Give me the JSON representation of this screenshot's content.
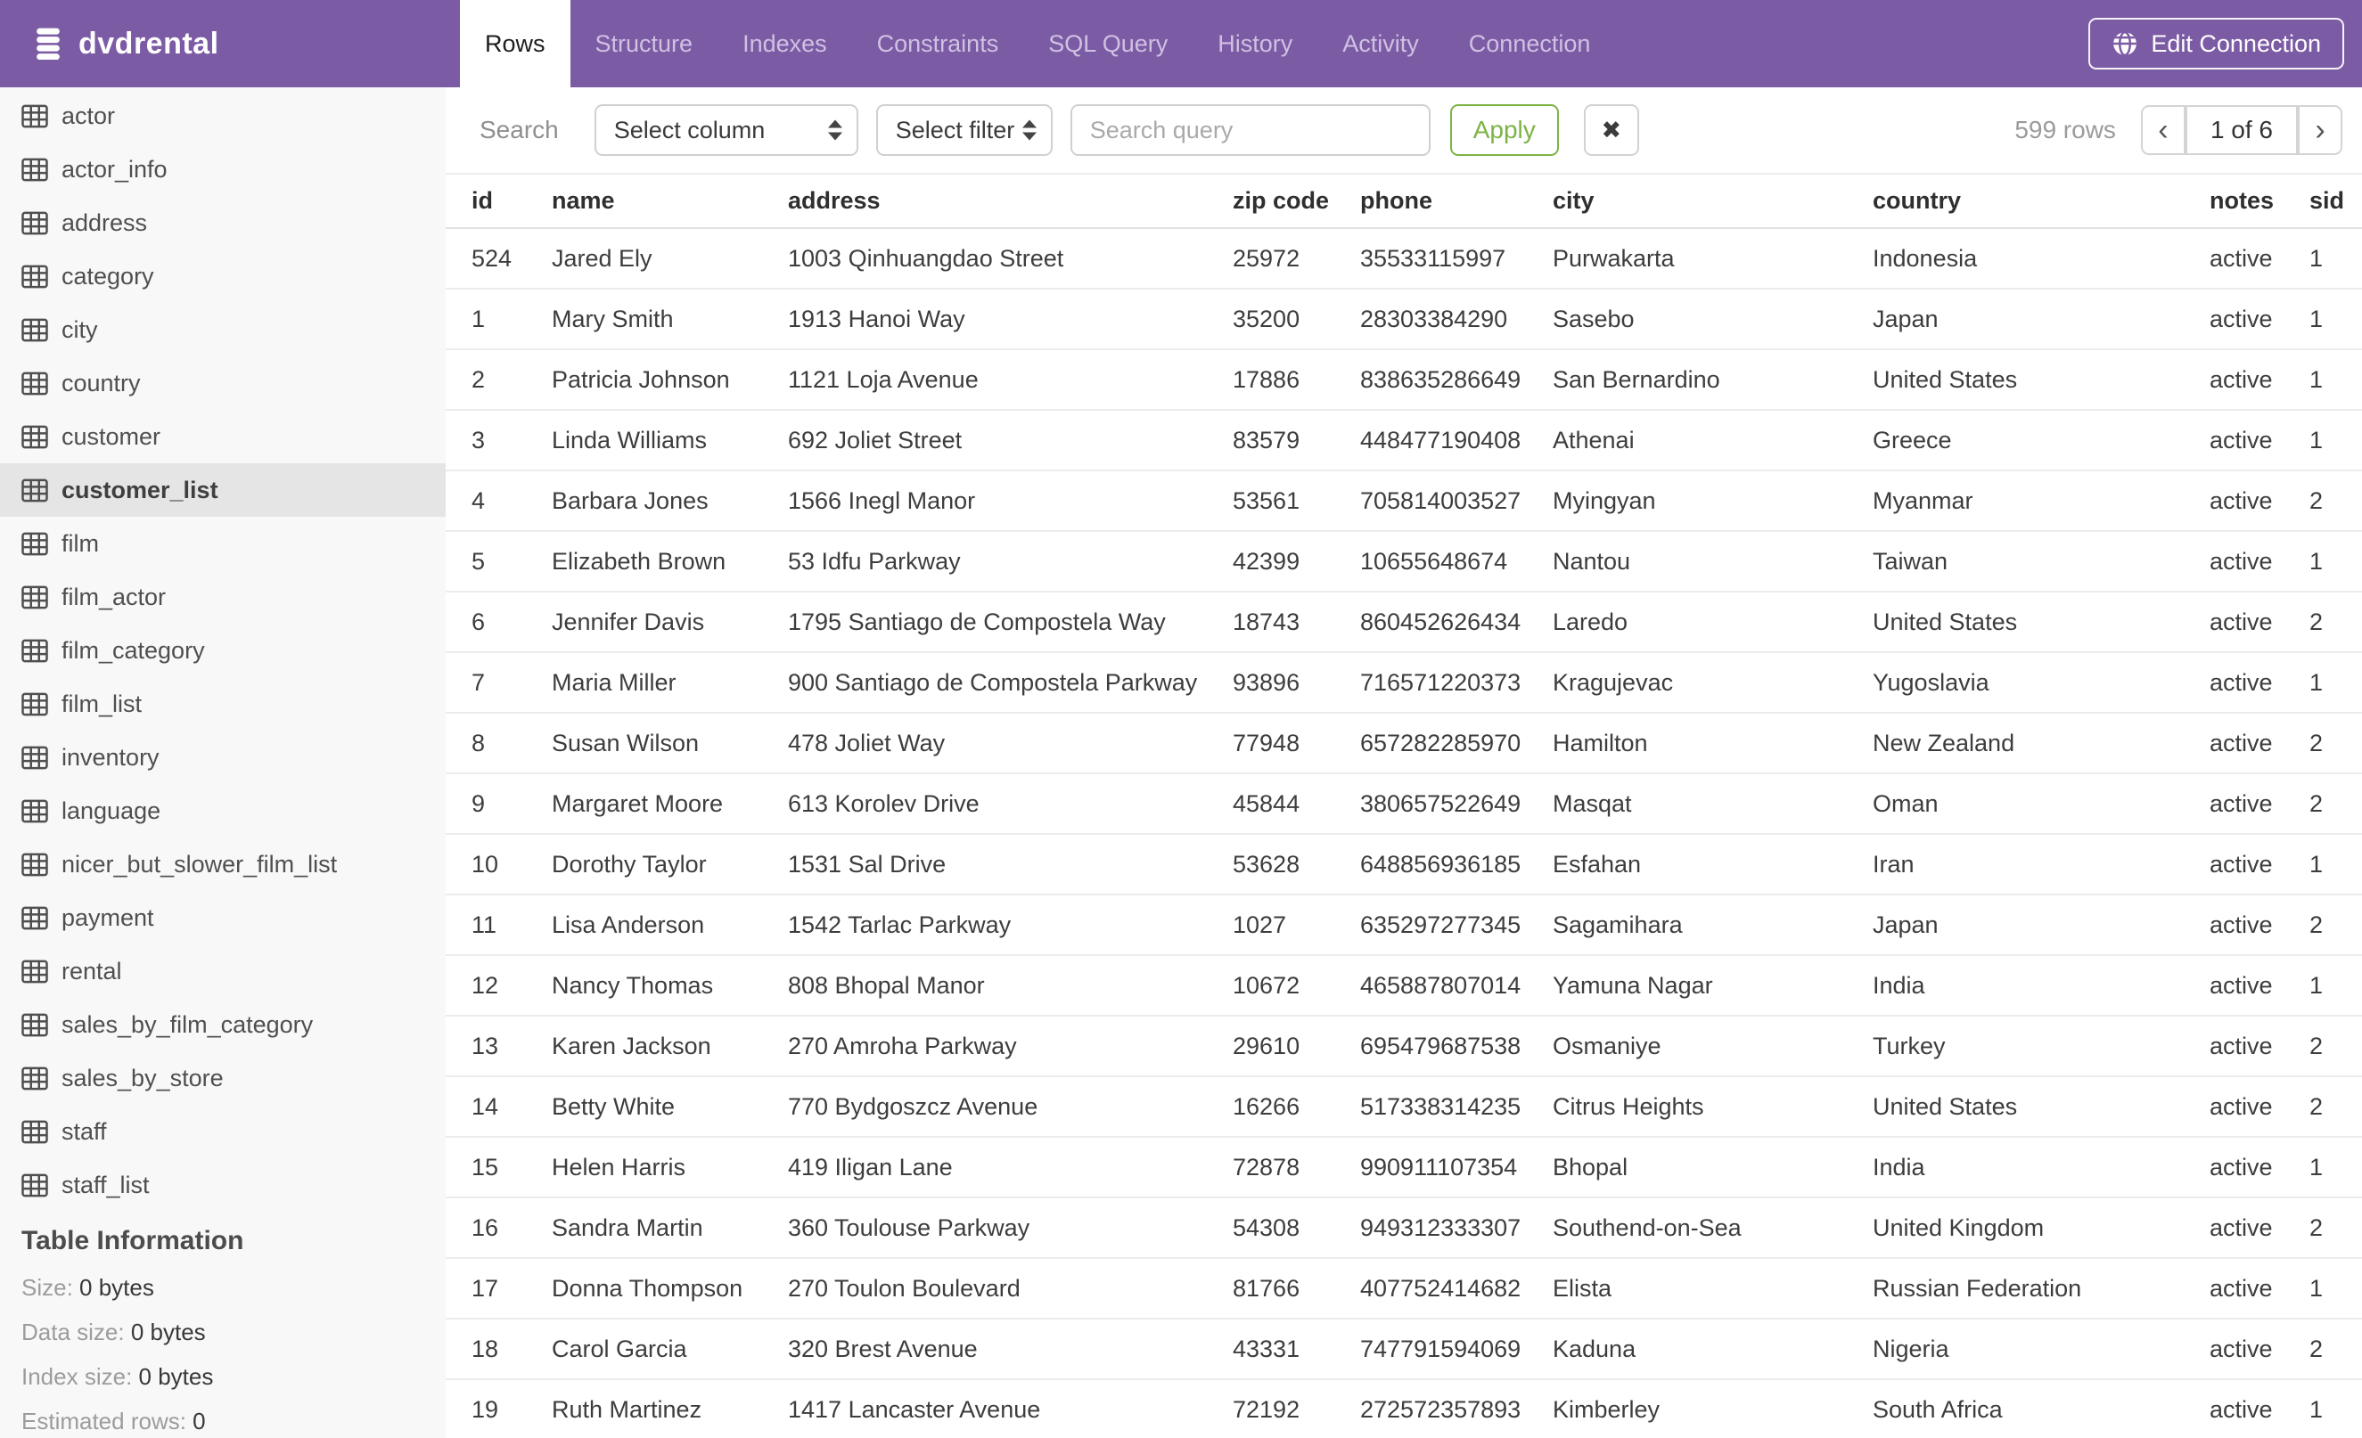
{
  "header": {
    "brand": "dvdrental",
    "tabs": [
      {
        "label": "Rows",
        "active": true
      },
      {
        "label": "Structure",
        "active": false
      },
      {
        "label": "Indexes",
        "active": false
      },
      {
        "label": "Constraints",
        "active": false
      },
      {
        "label": "SQL Query",
        "active": false
      },
      {
        "label": "History",
        "active": false
      },
      {
        "label": "Activity",
        "active": false
      },
      {
        "label": "Connection",
        "active": false
      }
    ],
    "edit_connection_label": "Edit Connection"
  },
  "toolbar": {
    "search_label": "Search",
    "column_select_value": "Select column",
    "filter_select_value": "Select filter",
    "query_placeholder": "Search query",
    "query_value": "",
    "apply_label": "Apply",
    "clear_icon": "✖",
    "rows_count": "599 rows",
    "pager": {
      "prev": "‹",
      "label": "1 of 6",
      "next": "›"
    }
  },
  "sidebar": {
    "tables": [
      "actor",
      "actor_info",
      "address",
      "category",
      "city",
      "country",
      "customer",
      "customer_list",
      "film",
      "film_actor",
      "film_category",
      "film_list",
      "inventory",
      "language",
      "nicer_but_slower_film_list",
      "payment",
      "rental",
      "sales_by_film_category",
      "sales_by_store",
      "staff",
      "staff_list"
    ],
    "selected": "customer_list",
    "info": {
      "title": "Table Information",
      "stats": [
        {
          "label": "Size:",
          "value": "0 bytes"
        },
        {
          "label": "Data size:",
          "value": "0 bytes"
        },
        {
          "label": "Index size:",
          "value": "0 bytes"
        },
        {
          "label": "Estimated rows:",
          "value": "0"
        }
      ]
    }
  },
  "table": {
    "columns": [
      "id",
      "name",
      "address",
      "zip code",
      "phone",
      "city",
      "country",
      "notes",
      "sid"
    ],
    "rows": [
      [
        "524",
        "Jared Ely",
        "1003 Qinhuangdao Street",
        "25972",
        "35533115997",
        "Purwakarta",
        "Indonesia",
        "active",
        "1"
      ],
      [
        "1",
        "Mary Smith",
        "1913 Hanoi Way",
        "35200",
        "28303384290",
        "Sasebo",
        "Japan",
        "active",
        "1"
      ],
      [
        "2",
        "Patricia Johnson",
        "1121 Loja Avenue",
        "17886",
        "838635286649",
        "San Bernardino",
        "United States",
        "active",
        "1"
      ],
      [
        "3",
        "Linda Williams",
        "692 Joliet Street",
        "83579",
        "448477190408",
        "Athenai",
        "Greece",
        "active",
        "1"
      ],
      [
        "4",
        "Barbara Jones",
        "1566 Inegl Manor",
        "53561",
        "705814003527",
        "Myingyan",
        "Myanmar",
        "active",
        "2"
      ],
      [
        "5",
        "Elizabeth Brown",
        "53 Idfu Parkway",
        "42399",
        "10655648674",
        "Nantou",
        "Taiwan",
        "active",
        "1"
      ],
      [
        "6",
        "Jennifer Davis",
        "1795 Santiago de Compostela Way",
        "18743",
        "860452626434",
        "Laredo",
        "United States",
        "active",
        "2"
      ],
      [
        "7",
        "Maria Miller",
        "900 Santiago de Compostela Parkway",
        "93896",
        "716571220373",
        "Kragujevac",
        "Yugoslavia",
        "active",
        "1"
      ],
      [
        "8",
        "Susan Wilson",
        "478 Joliet Way",
        "77948",
        "657282285970",
        "Hamilton",
        "New Zealand",
        "active",
        "2"
      ],
      [
        "9",
        "Margaret Moore",
        "613 Korolev Drive",
        "45844",
        "380657522649",
        "Masqat",
        "Oman",
        "active",
        "2"
      ],
      [
        "10",
        "Dorothy Taylor",
        "1531 Sal Drive",
        "53628",
        "648856936185",
        "Esfahan",
        "Iran",
        "active",
        "1"
      ],
      [
        "11",
        "Lisa Anderson",
        "1542 Tarlac Parkway",
        "1027",
        "635297277345",
        "Sagamihara",
        "Japan",
        "active",
        "2"
      ],
      [
        "12",
        "Nancy Thomas",
        "808 Bhopal Manor",
        "10672",
        "465887807014",
        "Yamuna Nagar",
        "India",
        "active",
        "1"
      ],
      [
        "13",
        "Karen Jackson",
        "270 Amroha Parkway",
        "29610",
        "695479687538",
        "Osmaniye",
        "Turkey",
        "active",
        "2"
      ],
      [
        "14",
        "Betty White",
        "770 Bydgoszcz Avenue",
        "16266",
        "517338314235",
        "Citrus Heights",
        "United States",
        "active",
        "2"
      ],
      [
        "15",
        "Helen Harris",
        "419 Iligan Lane",
        "72878",
        "990911107354",
        "Bhopal",
        "India",
        "active",
        "1"
      ],
      [
        "16",
        "Sandra Martin",
        "360 Toulouse Parkway",
        "54308",
        "949312333307",
        "Southend-on-Sea",
        "United Kingdom",
        "active",
        "2"
      ],
      [
        "17",
        "Donna Thompson",
        "270 Toulon Boulevard",
        "81766",
        "407752414682",
        "Elista",
        "Russian Federation",
        "active",
        "1"
      ],
      [
        "18",
        "Carol Garcia",
        "320 Brest Avenue",
        "43331",
        "747791594069",
        "Kaduna",
        "Nigeria",
        "active",
        "2"
      ],
      [
        "19",
        "Ruth Martinez",
        "1417 Lancaster Avenue",
        "72192",
        "272572357893",
        "Kimberley",
        "South Africa",
        "active",
        "1"
      ]
    ]
  },
  "colors": {
    "header_purple": "#7c5ba5",
    "inactive_tab_text": "#cfc1e2",
    "accent_green": "#7db344",
    "sidebar_bg": "#f8f8f8",
    "selected_item_bg": "#e5e5e5"
  }
}
